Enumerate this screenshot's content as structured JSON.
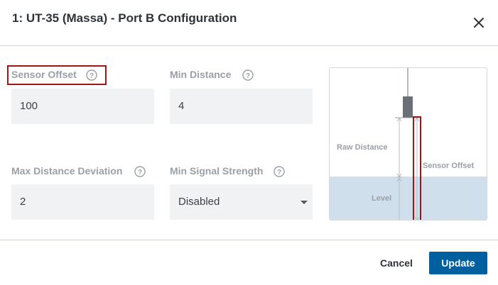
{
  "dialog": {
    "title": "1: UT-35 (Massa) - Port B Configuration"
  },
  "fields": {
    "sensor_offset": {
      "label": "Sensor Offset",
      "value": "100"
    },
    "min_distance": {
      "label": "Min Distance",
      "value": "4"
    },
    "max_distance_deviation": {
      "label": "Max Distance Deviation",
      "value": "2"
    },
    "min_signal_strength": {
      "label": "Min Signal Strength",
      "value": "Disabled"
    }
  },
  "diagram": {
    "raw_distance_label": "Raw Distance",
    "sensor_offset_label": "Sensor Offset",
    "level_label": "Level"
  },
  "buttons": {
    "cancel": "Cancel",
    "update": "Update"
  },
  "colors": {
    "accent": "#005f9e",
    "highlight": "#a01515",
    "water": "#cfdfec",
    "field_bg": "#f1f2f4"
  },
  "icons": {
    "close": "close-icon",
    "help": "help-circle-icon",
    "dropdown": "chevron-down-icon"
  }
}
